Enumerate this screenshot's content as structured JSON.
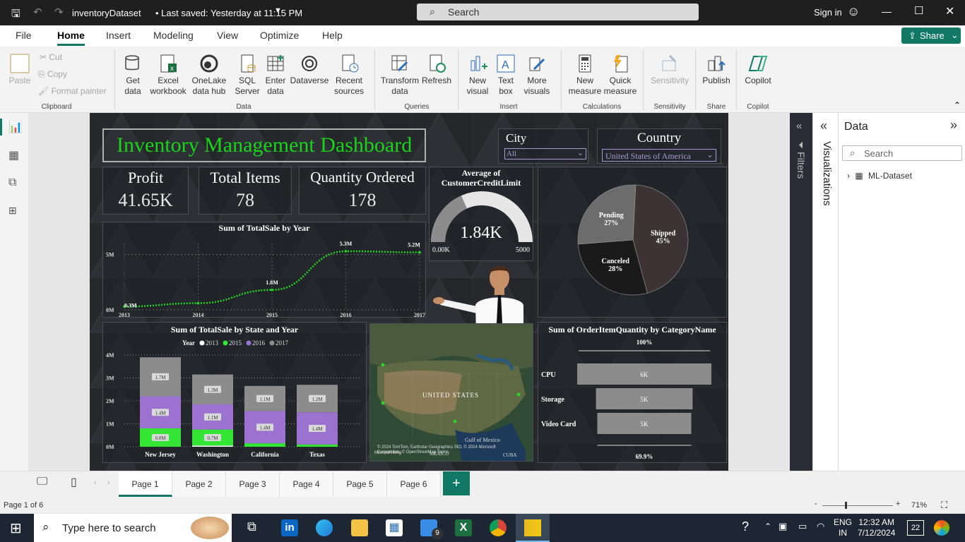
{
  "window": {
    "file_title": "inventoryDataset",
    "save_status": "• Last saved: Yesterday at 11:15 PM",
    "search_placeholder": "Search",
    "sign_in": "Sign in"
  },
  "menu": {
    "items": [
      "File",
      "Home",
      "Insert",
      "Modeling",
      "View",
      "Optimize",
      "Help"
    ],
    "active": "Home",
    "share": "Share"
  },
  "ribbon": {
    "clipboard": {
      "paste": "Paste",
      "cut": "Cut",
      "copy": "Copy",
      "format_painter": "Format painter",
      "group": "Clipboard"
    },
    "data": {
      "get_data": "Get data",
      "excel": "Excel workbook",
      "onelake": "OneLake data hub",
      "sql": "SQL Server",
      "enter": "Enter data",
      "dataverse": "Dataverse",
      "recent": "Recent sources",
      "group": "Data"
    },
    "queries": {
      "transform": "Transform data",
      "refresh": "Refresh",
      "group": "Queries"
    },
    "insert": {
      "new_visual": "New visual",
      "text_box": "Text box",
      "more_visuals": "More visuals",
      "group": "Insert"
    },
    "calculations": {
      "new_measure": "New measure",
      "quick_measure": "Quick measure",
      "group": "Calculations"
    },
    "sensitivity": {
      "label": "Sensitivity",
      "group": "Sensitivity"
    },
    "share": {
      "publish": "Publish",
      "group": "Share"
    },
    "copilot": {
      "label": "Copilot",
      "group": "Copilot"
    }
  },
  "dashboard": {
    "title": "Inventory Management Dashboard",
    "city_label": "City",
    "city_value": "All",
    "country_label": "Country",
    "country_value": "United States of America",
    "kpis": [
      {
        "label": "Profit",
        "value": "41.65K"
      },
      {
        "label": "Total Items",
        "value": "78"
      },
      {
        "label": "Quantity Ordered",
        "value": "178"
      }
    ],
    "gauge": {
      "title": "Average of CustomerCreditLimit",
      "value": "1.84K",
      "min": "0.00K",
      "max": "5000",
      "fraction": 0.368
    },
    "map": {
      "country_label": "UNITED STATES",
      "gulf": "Gulf of Mexico",
      "mexico": "MEXICO",
      "cuba": "CUBA",
      "attribution": "© 2024 TomTom, Earthstar Geographics SIO, © 2024 Microsoft Corporation, © OpenStreetMap Terms",
      "bing": "Microsoft Bing"
    }
  },
  "chart_data": [
    {
      "type": "line",
      "title": "Sum of TotalSale by Year",
      "x": [
        "2013",
        "2014",
        "2015",
        "2016",
        "2017"
      ],
      "series": [
        {
          "values": [
            0.3,
            0.6,
            1.8,
            5.3,
            5.2
          ]
        }
      ],
      "point_labels": [
        {
          "x": "2013",
          "label": "0.3M"
        },
        {
          "x": "2015",
          "label": "1.8M"
        },
        {
          "x": "2016",
          "label": "5.3M"
        },
        {
          "x": "2017",
          "label": "5.2M"
        }
      ],
      "yticks": [
        "0M",
        "5M"
      ],
      "ylim": [
        0,
        6
      ],
      "color": "#22d722"
    },
    {
      "type": "pie",
      "slices": [
        {
          "label": "Shipped",
          "pct": 45,
          "color": "#3c3434"
        },
        {
          "label": "Canceled",
          "pct": 28,
          "color": "#1a1a1a"
        },
        {
          "label": "Pending",
          "pct": 27,
          "color": "#6c6c6c"
        }
      ]
    },
    {
      "type": "bar",
      "stacked": true,
      "title": "Sum of TotalSale by State and Year",
      "legend_title": "Year",
      "categories": [
        "New Jersey",
        "Washington",
        "California",
        "Texas"
      ],
      "series": [
        {
          "name": "2013",
          "color": "#ffffff",
          "values": [
            0,
            0.05,
            0,
            0
          ],
          "labels": [
            "",
            "",
            "",
            ""
          ]
        },
        {
          "name": "2015",
          "color": "#33e633",
          "values": [
            0.8,
            0.7,
            0.15,
            0.1
          ],
          "labels": [
            "0.8M",
            "0.7M",
            "",
            ""
          ]
        },
        {
          "name": "2016",
          "color": "#9b72cf",
          "values": [
            1.4,
            1.1,
            1.4,
            1.4
          ],
          "labels": [
            "1.4M",
            "1.1M",
            "1.4M",
            "1.4M"
          ]
        },
        {
          "name": "2017",
          "color": "#8c8c8c",
          "values": [
            1.7,
            1.3,
            1.1,
            1.2
          ],
          "labels": [
            "1.7M",
            "1.3M",
            "1.1M",
            "1.2M"
          ]
        }
      ],
      "yticks": [
        "0M",
        "1M",
        "2M",
        "3M",
        "4M"
      ],
      "ylim": [
        0,
        4
      ]
    },
    {
      "type": "bar",
      "subtype": "funnel",
      "title": "Sum of OrderItemQuantity by CategoryName",
      "top_label": "100%",
      "bottom_label": "69.9%",
      "categories": [
        "CPU",
        "Storage",
        "Video Card"
      ],
      "values": [
        6,
        5,
        5
      ],
      "labels": [
        "6K",
        "5K",
        "5K"
      ],
      "widths": [
        1,
        0.72,
        0.7
      ]
    }
  ],
  "right": {
    "filters": "Filters",
    "visualizations": "Visualizations",
    "data_title": "Data",
    "search_placeholder": "Search",
    "dataset": "ML-Dataset"
  },
  "pages": [
    "Page 1",
    "Page 2",
    "Page 3",
    "Page 4",
    "Page 5",
    "Page 6"
  ],
  "status": {
    "page_of": "Page 1 of 6",
    "zoom": "71%"
  },
  "taskbar": {
    "search_placeholder": "Type here to search",
    "lang1": "ENG",
    "lang2": "IN",
    "time": "12:32 AM",
    "date": "7/12/2024",
    "mail_badge": "9",
    "notif": "22"
  }
}
